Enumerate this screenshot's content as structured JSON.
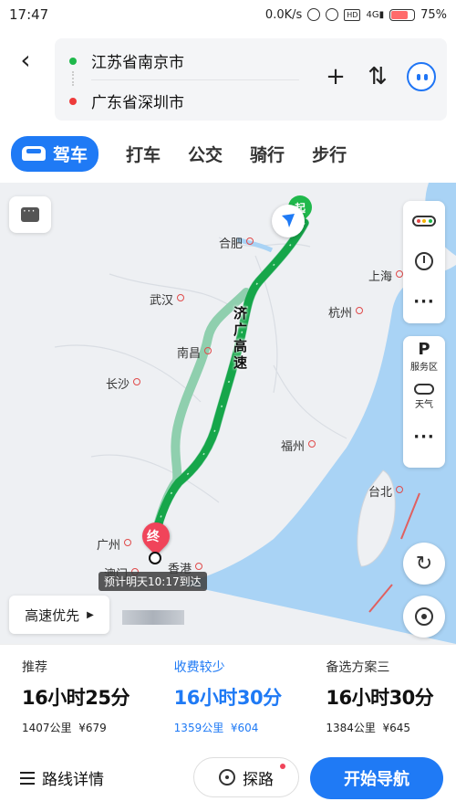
{
  "status_bar": {
    "time": "17:47",
    "net_speed": "0.0K/s",
    "battery": "75%",
    "battery_level": 0.75
  },
  "route_input": {
    "origin": "江苏省南京市",
    "destination": "广东省深圳市",
    "add_label": "+",
    "swap_label": "⇅"
  },
  "tabs": [
    {
      "label": "驾车",
      "active": true
    },
    {
      "label": "打车"
    },
    {
      "label": "公交"
    },
    {
      "label": "骑行"
    },
    {
      "label": "步行"
    }
  ],
  "map": {
    "cities": {
      "hefei": "合肥",
      "shanghai": "上海",
      "wuhan": "武汉",
      "hangzhou": "杭州",
      "nanchang": "南昌",
      "changsha": "长沙",
      "fuzhou": "福州",
      "taipei": "台北",
      "guangzhou": "广州",
      "macau": "澳门",
      "hongkong": "香港"
    },
    "highway_label": "济广高速",
    "start_marker": "起",
    "end_marker": "终",
    "eta": "预计明天10:17到达",
    "preference": "高速优先",
    "preference_arrow": "▶",
    "side_tools": {
      "service_area": "服务区",
      "weather": "天气",
      "parking_letter": "P",
      "more": "···"
    },
    "colors": {
      "route_main": "#16a64a",
      "route_alt": "#8fcfae",
      "water": "#a9d3f5"
    }
  },
  "route_options": [
    {
      "tag": "推荐",
      "duration": "16小时25分",
      "distance": "1407公里",
      "cost": "¥679",
      "selected": false
    },
    {
      "tag": "收费较少",
      "duration": "16小时30分",
      "distance": "1359公里",
      "cost": "¥604",
      "selected": true
    },
    {
      "tag": "备选方案三",
      "duration": "16小时30分",
      "distance": "1384公里",
      "cost": "¥645",
      "selected": false
    }
  ],
  "bottom_bar": {
    "details": "路线详情",
    "explore": "探路",
    "start_nav": "开始导航"
  },
  "colors": {
    "accent": "#1f7af5",
    "start_green": "#1fb84b",
    "end_red": "#f0445a"
  }
}
